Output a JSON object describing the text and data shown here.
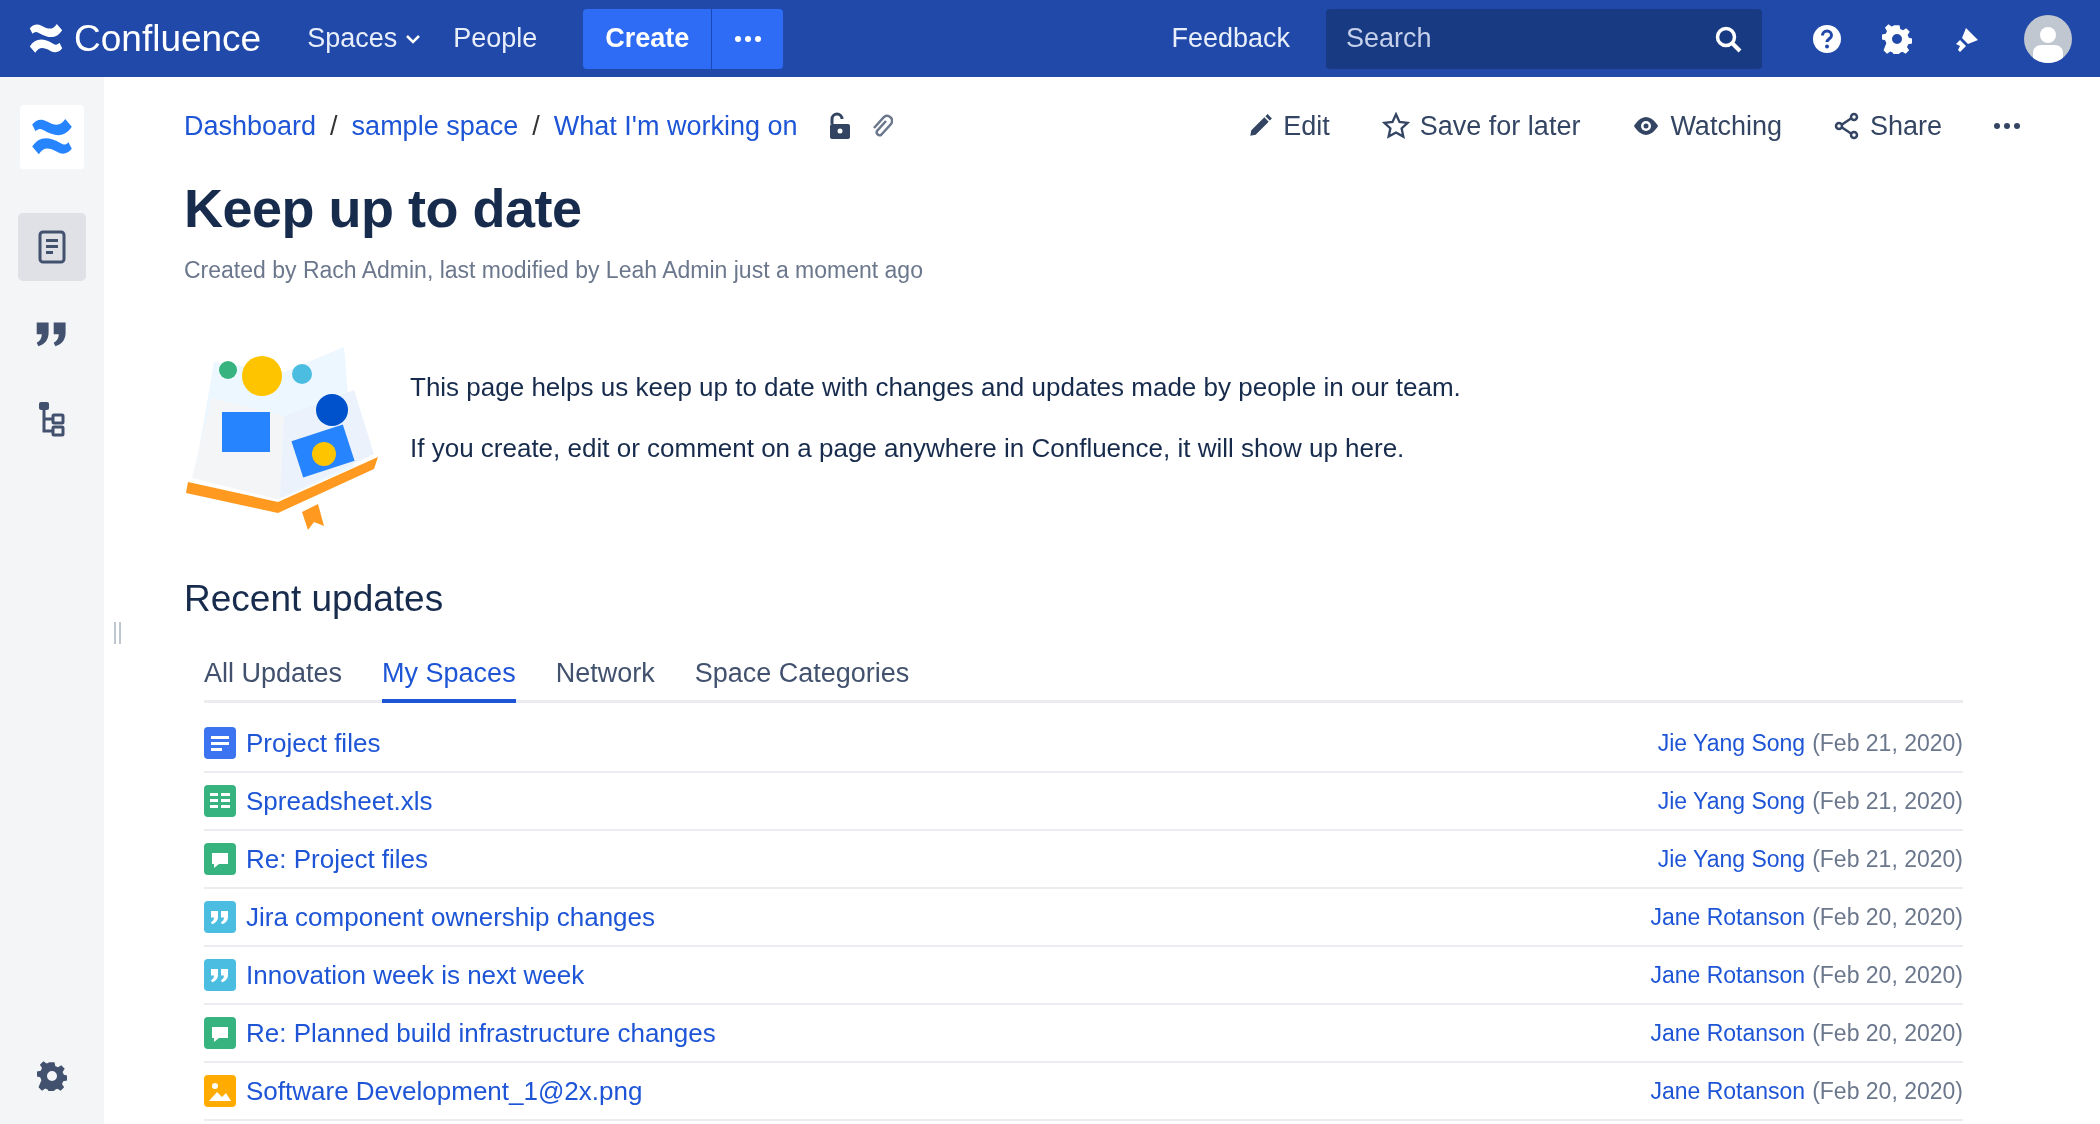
{
  "topbar": {
    "logo": "Confluence",
    "nav": [
      {
        "label": "Spaces",
        "dropdown": true
      },
      {
        "label": "People",
        "dropdown": false
      }
    ],
    "create": "Create",
    "feedback": "Feedback",
    "search": {
      "placeholder": "Search"
    }
  },
  "sidebar": {
    "items": [
      {
        "kind": "pages",
        "selected": true
      },
      {
        "kind": "blog",
        "selected": false
      },
      {
        "kind": "tree",
        "selected": false
      }
    ]
  },
  "breadcrumbs": [
    {
      "label": "Dashboard"
    },
    {
      "separator": "/",
      "label": "sample space"
    },
    {
      "separator": "/",
      "label": "What I'm working on"
    }
  ],
  "actions": [
    {
      "kind": "edit",
      "label": "Edit"
    },
    {
      "kind": "save",
      "label": "Save for later"
    },
    {
      "kind": "watch",
      "label": "Watching"
    },
    {
      "kind": "share",
      "label": "Share"
    }
  ],
  "page": {
    "title": "Keep up to date",
    "byline": "Created by Rach Admin, last modified by Leah Admin just a moment ago",
    "intro": [
      "This page helps us keep up to date with changes and updates made by people in our team.",
      "If you create, edit or comment on a page anywhere in Confluence, it will show up here."
    ]
  },
  "recent": {
    "heading": "Recent updates",
    "tabs": [
      {
        "label": "All Updates",
        "selected": false
      },
      {
        "label": "My Spaces",
        "selected": true
      },
      {
        "label": "Network",
        "selected": false
      },
      {
        "label": "Space Categories",
        "selected": false
      }
    ],
    "rows": [
      {
        "kind": "page",
        "title": "Project files",
        "author": "Jie Yang Song",
        "date": "(Feb 21, 2020)"
      },
      {
        "kind": "spreadsheet",
        "title": "Spreadsheet.xls",
        "author": "Jie Yang Song",
        "date": "(Feb 21, 2020)"
      },
      {
        "kind": "comment",
        "title": "Re: Project files",
        "author": "Jie Yang Song",
        "date": "(Feb 21, 2020)"
      },
      {
        "kind": "blog",
        "title": "Jira component ownership changes",
        "author": "Jane Rotanson",
        "date": "(Feb 20, 2020)"
      },
      {
        "kind": "blog",
        "title": "Innovation week is next week",
        "author": "Jane Rotanson",
        "date": "(Feb 20, 2020)"
      },
      {
        "kind": "comment",
        "title": "Re: Planned build infrastructure changes",
        "author": "Jane Rotanson",
        "date": "(Feb 20, 2020)"
      },
      {
        "kind": "image",
        "title": "Software Development_1@2x.png",
        "author": "Jane Rotanson",
        "date": "(Feb 20, 2020)"
      }
    ]
  }
}
